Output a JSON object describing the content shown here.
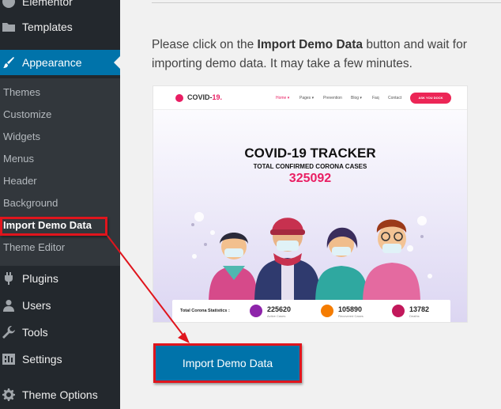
{
  "sidebar": {
    "top_items": [
      {
        "label": "Elementor",
        "icon": "elementor-icon"
      },
      {
        "label": "Templates",
        "icon": "folder-icon"
      },
      {
        "label": "Appearance",
        "icon": "paintbrush-icon"
      },
      {
        "label": "Plugins",
        "icon": "plug-icon"
      },
      {
        "label": "Users",
        "icon": "user-icon"
      },
      {
        "label": "Tools",
        "icon": "wrench-icon"
      },
      {
        "label": "Settings",
        "icon": "settings-icon"
      },
      {
        "label": "Theme Options",
        "icon": "gear-icon"
      }
    ],
    "submenu": [
      "Themes",
      "Customize",
      "Widgets",
      "Menus",
      "Header",
      "Background",
      "Import Demo Data",
      "Theme Editor"
    ]
  },
  "main": {
    "instruction_pre": "Please click on the ",
    "instruction_bold": "Import Demo Data",
    "instruction_post": " button and wait for importing demo data. It may take a few minutes.",
    "import_button_label": "Import Demo Data"
  },
  "preview": {
    "logo_text": "COVID-",
    "logo_accent": "19.",
    "nav": [
      "Home ▾",
      "Pages ▾",
      "Prevention",
      "Blog ▾",
      "Faq",
      "Contact"
    ],
    "cta": "ASK YOU DOCK",
    "title": "COVID-19 TRACKER",
    "subtitle": "TOTAL CONFIRMED CORONA CASES",
    "count": "325092",
    "stats_label": "Total Corona Statistics :",
    "stats": [
      {
        "value": "225620",
        "label": "Active Cases",
        "color": "#8e24aa"
      },
      {
        "value": "105890",
        "label": "Recovered Cases",
        "color": "#f57c00"
      },
      {
        "value": "13782",
        "label": "Deaths",
        "color": "#c2185b"
      }
    ]
  },
  "colors": {
    "sidebar_bg": "#23282d",
    "submenu_bg": "#32373c",
    "active_blue": "#0073aa",
    "annotation_red": "#e0151d"
  }
}
